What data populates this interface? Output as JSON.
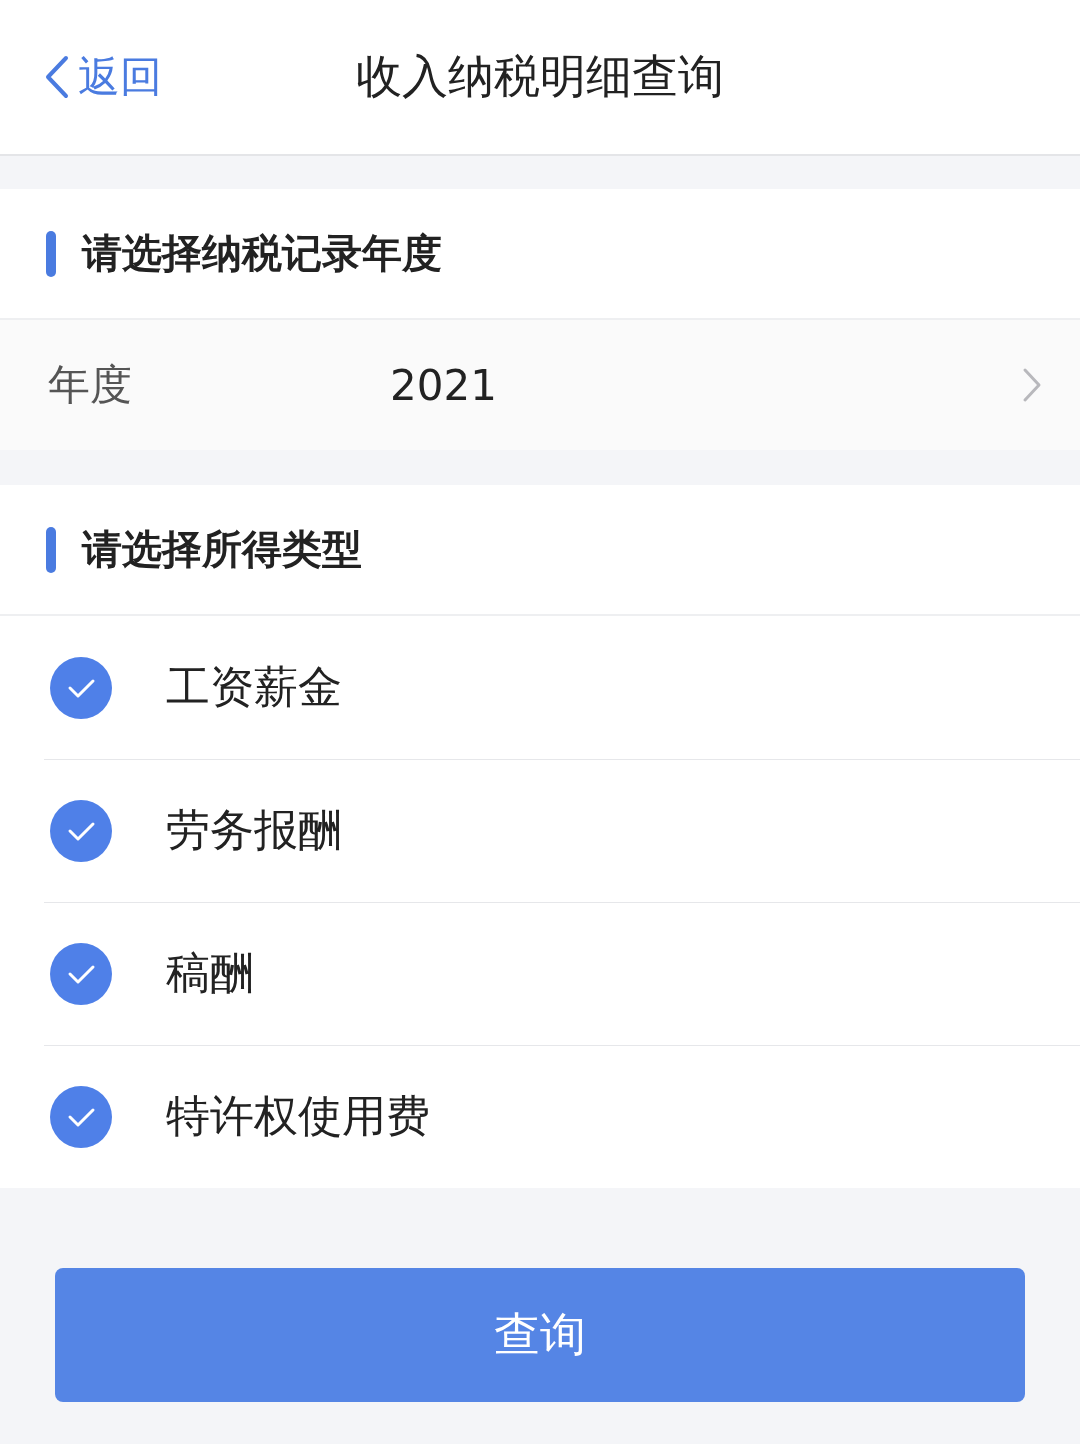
{
  "nav_bar": {
    "back_label": "返回",
    "title": "收入纳税明细查询"
  },
  "year_section": {
    "title": "请选择纳税记录年度",
    "field": {
      "label": "年度",
      "value": "2021"
    }
  },
  "income_section": {
    "title": "请选择所得类型",
    "options": [
      {
        "label": "工资薪金",
        "checked": true
      },
      {
        "label": "劳务报酬",
        "checked": true
      },
      {
        "label": "稿酬",
        "checked": true
      },
      {
        "label": "特许权使用费",
        "checked": true
      }
    ]
  },
  "query_button": {
    "label": "查询"
  }
}
